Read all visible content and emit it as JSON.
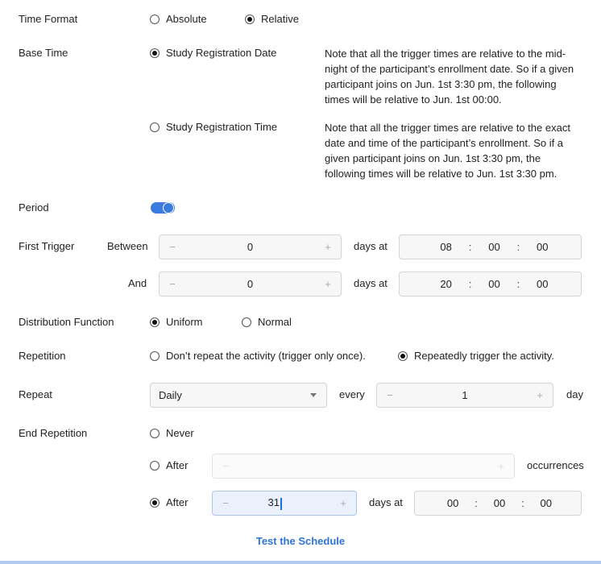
{
  "time_format": {
    "label": "Time Format",
    "options": [
      {
        "label": "Absolute",
        "selected": false
      },
      {
        "label": "Relative",
        "selected": true
      }
    ]
  },
  "base_time": {
    "label": "Base Time",
    "options": [
      {
        "label": "Study Registration Date",
        "selected": true,
        "note": "Note that all the trigger times are relative to the mid-night of the participant’s enrollment date. So if a given participant joins on Jun. 1st 3:30 pm, the following times will be relative to Jun. 1st 00:00."
      },
      {
        "label": "Study Registration Time",
        "selected": false,
        "note": "Note that all the trigger times are relative to the exact date and time of the participant’s enrollment. So if a given participant joins on Jun. 1st 3:30 pm, the following times will be relative to Jun. 1st 3:30 pm."
      }
    ]
  },
  "period": {
    "label": "Period",
    "enabled": true
  },
  "first_trigger": {
    "label": "First Trigger",
    "between_label": "Between",
    "and_label": "And",
    "days_at_label": "days at",
    "between": {
      "days": "0",
      "hh": "08",
      "mm": "00",
      "ss": "00"
    },
    "and": {
      "days": "0",
      "hh": "20",
      "mm": "00",
      "ss": "00"
    },
    "minus": "−",
    "plus": "+",
    "colon": ":"
  },
  "distribution": {
    "label": "Distribution Function",
    "options": [
      {
        "label": "Uniform",
        "selected": true
      },
      {
        "label": "Normal",
        "selected": false
      }
    ]
  },
  "repetition": {
    "label": "Repetition",
    "options": [
      {
        "label": "Don’t repeat the activity (trigger only once).",
        "selected": false
      },
      {
        "label": "Repeatedly trigger the activity.",
        "selected": true
      }
    ]
  },
  "repeat": {
    "label": "Repeat",
    "frequency": "Daily",
    "every_label": "every",
    "every_value": "1",
    "unit_label": "day"
  },
  "end_repetition": {
    "label": "End Repetition",
    "never_label": "Never",
    "never_selected": false,
    "after_occurrences_label": "After",
    "after_occurrences_selected": false,
    "occurrences_value": "",
    "occurrences_label": "occurrences",
    "after_days_label": "After",
    "after_days_selected": true,
    "days_value": "31",
    "days_at_label": "days at",
    "hh": "00",
    "mm": "00",
    "ss": "00"
  },
  "test_link": "Test the Schedule"
}
